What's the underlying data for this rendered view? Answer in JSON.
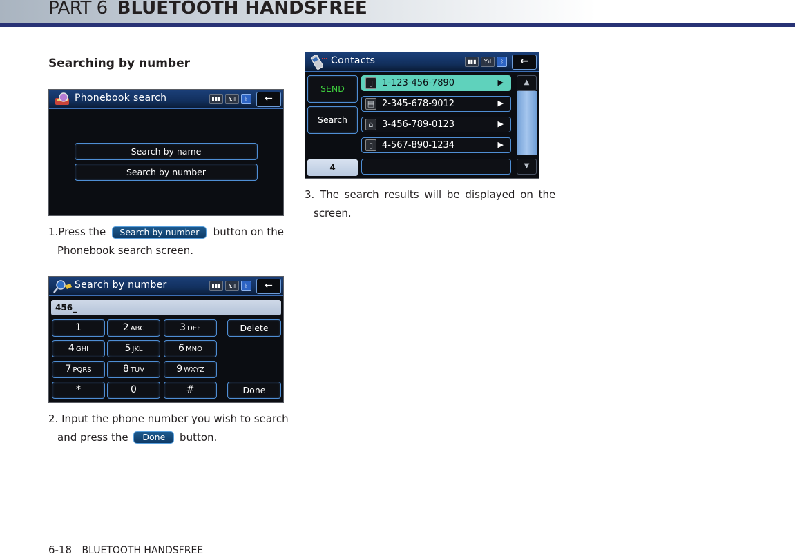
{
  "header": {
    "part": "PART 6",
    "section": "BLUETOOTH HANDSFREE",
    "accent_color": "#283275"
  },
  "section_title": "Searching by number",
  "screen1": {
    "title": "Phonebook search",
    "status_icons": [
      "battery-icon",
      "signal-icon",
      "bluetooth-icon"
    ],
    "battery_text": "▮▮▮",
    "signal_text": "Y.ıl",
    "bluetooth_text": "ᛒ",
    "back_label": "←",
    "buttons": [
      "Search by name",
      "Search by number"
    ]
  },
  "step1": {
    "prefix": "1.Press the",
    "button_label": "Search by number",
    "suffix": "button on the",
    "line2": "Phonebook search screen."
  },
  "screen2": {
    "title": "Search by number",
    "back_label": "←",
    "input_value": "456_",
    "keys": [
      {
        "main": "1",
        "sub": ""
      },
      {
        "main": "2",
        "sub": "ABC"
      },
      {
        "main": "3",
        "sub": "DEF"
      },
      {
        "main": "4",
        "sub": "GHI"
      },
      {
        "main": "5",
        "sub": "JKL"
      },
      {
        "main": "6",
        "sub": "MNO"
      },
      {
        "main": "7",
        "sub": "PQRS"
      },
      {
        "main": "8",
        "sub": "TUV"
      },
      {
        "main": "9",
        "sub": "WXYZ"
      },
      {
        "main": "*",
        "sub": ""
      },
      {
        "main": "0",
        "sub": ""
      },
      {
        "main": "#",
        "sub": ""
      }
    ],
    "delete_label": "Delete",
    "done_label": "Done"
  },
  "step2": {
    "line1": "2. Input the phone number you wish to search",
    "prefix": "and press the",
    "button_label": "Done",
    "suffix": "button."
  },
  "screen3": {
    "title": "Contacts",
    "back_label": "←",
    "send_label": "SEND",
    "send_color": "#3ecf3e",
    "search_label": "Search",
    "query_value": "4",
    "contacts": [
      {
        "number": "1-123-456-7890",
        "type": "mobile-icon",
        "glyph": "▯",
        "selected": true
      },
      {
        "number": "2-345-678-9012",
        "type": "office-icon",
        "glyph": "▤",
        "selected": false
      },
      {
        "number": "3-456-789-0123",
        "type": "home-icon",
        "glyph": "⌂",
        "selected": false
      },
      {
        "number": "4-567-890-1234",
        "type": "mobile-icon",
        "glyph": "▯",
        "selected": false
      }
    ],
    "arrow_glyph": "▶",
    "scroll_up_glyph": "▲",
    "scroll_down_glyph": "▼",
    "selected_color": "#5fd2bc"
  },
  "step3": {
    "line1": "3. The search results will be displayed on the",
    "line2": "screen."
  },
  "footer": {
    "page_number": "6-18",
    "section": "BLUETOOTH HANDSFREE"
  }
}
